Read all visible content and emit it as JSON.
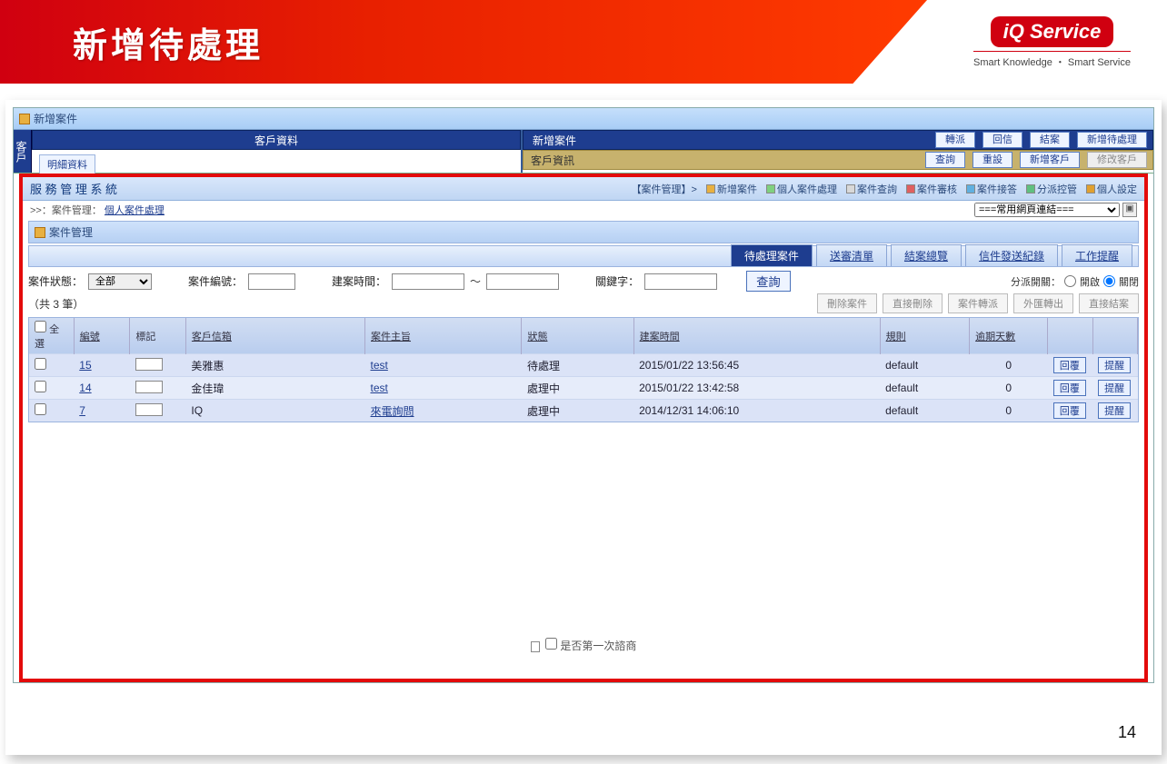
{
  "banner": {
    "title": "新增待處理"
  },
  "brand": {
    "logo": "iQ Service",
    "tag": "Smart Knowledge ・ Smart Service"
  },
  "outer_window_title": "新增案件",
  "sidevert_label": "客戶",
  "top": {
    "left_title": "客戶資料",
    "left_sub": "明細資料",
    "right_title": "新增案件",
    "right_sub": "客戶資訊",
    "right_btns": [
      "轉派",
      "回信",
      "結案",
      "新增待處理"
    ],
    "sub_btns": [
      "查詢",
      "重設",
      "新增客戶",
      "修改客戶"
    ]
  },
  "sys": {
    "name": "服 務 管 理 系 統",
    "section_head": "【案件管理】>",
    "links": [
      "新增案件",
      "個人案件處理",
      "案件查詢",
      "案件審核",
      "案件接答",
      "分派控管",
      "個人設定"
    ],
    "breadcrumb_prefix": ">>：案件管理：",
    "breadcrumb_link": "個人案件處理",
    "quicklinks_label": "===常用網頁連結==="
  },
  "cm_title": "案件管理",
  "tabs": [
    "待處理案件",
    "送審清單",
    "結案總覽",
    "信件發送紀錄",
    "工作提醒"
  ],
  "active_tab": 0,
  "filter": {
    "status_label": "案件狀態：",
    "status_value": "全部",
    "caseno_label": "案件編號：",
    "date_label": "建案時間：",
    "date_sep": "～",
    "keyword_label": "關鍵字：",
    "query_btn": "查詢",
    "dispatch_label": "分派開關：",
    "radio_on": "開啟",
    "radio_off": "關閉"
  },
  "count_text": "（共 3 筆）",
  "count_btns": [
    "刪除案件",
    "直接刪除",
    "案件轉派",
    "外匯轉出",
    "直接結案"
  ],
  "cols": {
    "all": "全選",
    "no": "編號",
    "tag": "標記",
    "mailbox": "客戶信箱",
    "subject": "案件主旨",
    "status": "狀態",
    "created": "建案時間",
    "rule": "規則",
    "overdue": "逾期天數",
    "reply": "回覆",
    "remind": "提醒"
  },
  "rows": [
    {
      "no": "15",
      "mailbox": "美雅惠",
      "subject": "test",
      "status": "待處理",
      "created": "2015/01/22 13:56:45",
      "rule": "default",
      "overdue": "0"
    },
    {
      "no": "14",
      "mailbox": "金佳瑋",
      "subject": "test",
      "status": "處理中",
      "created": "2015/01/22 13:42:58",
      "rule": "default",
      "overdue": "0"
    },
    {
      "no": "7",
      "mailbox": "IQ",
      "subject": "來電詢問",
      "status": "處理中",
      "created": "2014/12/31 14:06:10",
      "rule": "default",
      "overdue": "0"
    }
  ],
  "footer_note": "是否第一次諮商",
  "page_num": "14"
}
